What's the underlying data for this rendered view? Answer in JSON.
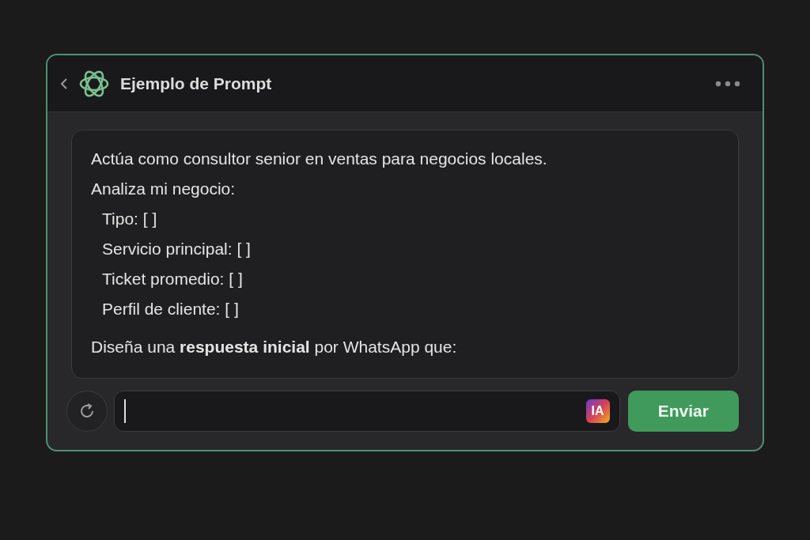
{
  "header": {
    "title": "Ejemplo de Prompt"
  },
  "prompt": {
    "lines": [
      {
        "kind": "line",
        "text": "Actúa como consultor senior en ventas para negocios locales."
      },
      {
        "kind": "line",
        "text": "Analiza mi negocio:"
      },
      {
        "kind": "item",
        "text": "Tipo: [ ]"
      },
      {
        "kind": "item",
        "text": "Servicio principal: [ ]"
      },
      {
        "kind": "item",
        "text": "Ticket promedio: [ ]"
      },
      {
        "kind": "item",
        "text": "Perfil de cliente: [ ]"
      },
      {
        "kind": "line",
        "text": "Diseña una **respuesta inicial** por WhatsApp que:"
      }
    ]
  },
  "input": {
    "badge": "IA"
  },
  "send_button": {
    "label": "Enviar"
  }
}
